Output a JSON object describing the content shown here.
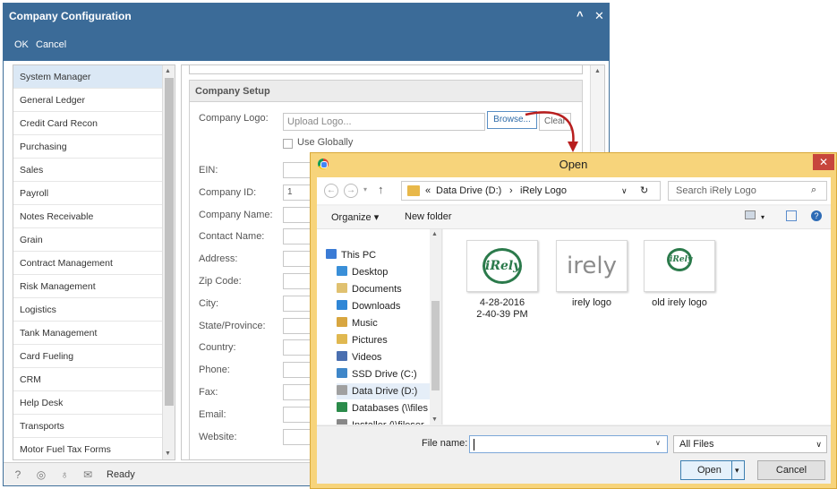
{
  "company_config": {
    "title": "Company Configuration",
    "controls": {
      "collapse": "^",
      "close": "✕"
    },
    "toolbar": {
      "ok": "OK",
      "cancel": "Cancel"
    },
    "modules": [
      "System Manager",
      "General Ledger",
      "Credit Card Recon",
      "Purchasing",
      "Sales",
      "Payroll",
      "Notes Receivable",
      "Grain",
      "Contract Management",
      "Risk Management",
      "Logistics",
      "Tank Management",
      "Card Fueling",
      "CRM",
      "Help Desk",
      "Transports",
      "Motor Fuel Tax Forms"
    ],
    "selected_module": "System Manager",
    "setup": {
      "heading": "Company Setup",
      "logo_label": "Company Logo:",
      "logo_placeholder": "Upload Logo...",
      "browse": "Browse...",
      "clear": "Clear",
      "use_globally": "Use Globally",
      "fields": [
        {
          "label": "EIN:",
          "value": ""
        },
        {
          "label": "Company ID:",
          "value": "1"
        },
        {
          "label": "Company Name:",
          "value": ""
        },
        {
          "label": "Contact Name:",
          "value": ""
        },
        {
          "label": "Address:",
          "value": ""
        },
        {
          "label": "Zip Code:",
          "value": ""
        },
        {
          "label": "City:",
          "value": ""
        },
        {
          "label": "State/Province:",
          "value": ""
        },
        {
          "label": "Country:",
          "value": ""
        },
        {
          "label": "Phone:",
          "value": ""
        },
        {
          "label": "Fax:",
          "value": ""
        },
        {
          "label": "Email:",
          "value": ""
        },
        {
          "label": "Website:",
          "value": ""
        }
      ]
    },
    "status": {
      "text": "Ready",
      "icons": [
        "help-icon",
        "support-icon",
        "idea-icon",
        "mail-icon"
      ]
    }
  },
  "open_dialog": {
    "title": "Open",
    "path": {
      "prefix": "«",
      "drive": "Data Drive (D:)",
      "sep": "›",
      "folder": "iRely Logo"
    },
    "search_placeholder": "Search iRely Logo",
    "organize": "Organize ▾",
    "new_folder": "New folder",
    "nav_items": [
      {
        "label": "This PC",
        "color": "#3a7bd5"
      },
      {
        "label": "Desktop",
        "color": "#3a8fd8"
      },
      {
        "label": "Documents",
        "color": "#e0c170"
      },
      {
        "label": "Downloads",
        "color": "#2f86d6"
      },
      {
        "label": "Music",
        "color": "#d8a640"
      },
      {
        "label": "Pictures",
        "color": "#e0b850"
      },
      {
        "label": "Videos",
        "color": "#4a6fb0"
      },
      {
        "label": "SSD Drive (C:)",
        "color": "#3f87c9"
      },
      {
        "label": "Data Drive (D:)",
        "color": "#a0a0a0"
      },
      {
        "label": "Databases (\\\\files",
        "color": "#2b8b4a"
      },
      {
        "label": "Installer (\\\\fileser",
        "color": "#888888"
      }
    ],
    "selected_nav": "Data Drive (D:)",
    "files": [
      {
        "name_line1": "4-28-2016",
        "name_line2": "2-40-39 PM",
        "logo": "iRely"
      },
      {
        "name_line1": "irely logo",
        "name_line2": "",
        "logo": "irely"
      },
      {
        "name_line1": "old irely logo",
        "name_line2": "",
        "logo": "iRely"
      }
    ],
    "file_name_label": "File name:",
    "file_type": "All Files",
    "open": "Open",
    "cancel": "Cancel"
  }
}
